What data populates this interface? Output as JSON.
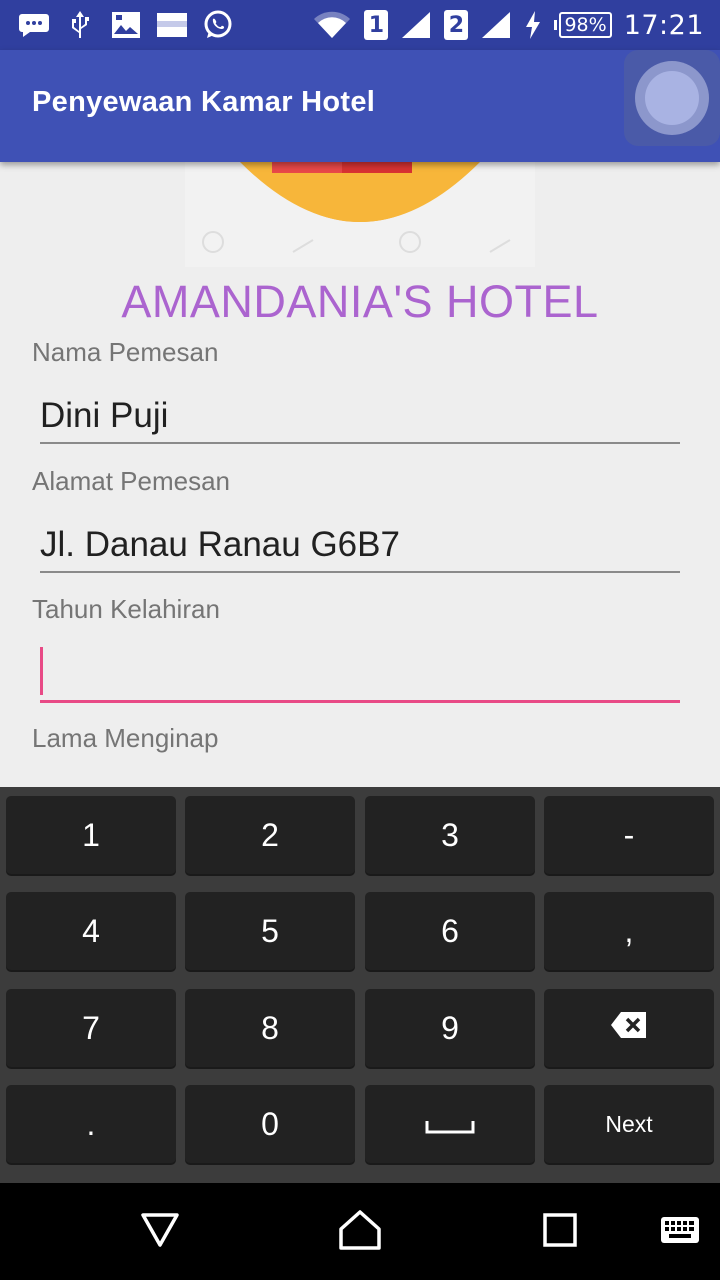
{
  "status_bar": {
    "time": "17:21",
    "battery": "98%",
    "sim1": "1",
    "sim2": "2",
    "icons": [
      "chat-icon",
      "usb-icon",
      "image-icon",
      "gallery-icon",
      "whatsapp-icon",
      "wifi-icon",
      "signal-icon",
      "charging-icon"
    ]
  },
  "toolbar": {
    "title": "Penyewaan Kamar Hotel"
  },
  "hotel_name": "AMANDANIA'S HOTEL",
  "form": {
    "nama_label": "Nama Pemesan",
    "nama_value": "Dini Puji",
    "alamat_label": "Alamat Pemesan",
    "alamat_value": "Jl. Danau Ranau G6B7",
    "tahun_label": "Tahun Kelahiran",
    "tahun_value": "",
    "lama_label": "Lama Menginap"
  },
  "keyboard": {
    "keys": [
      "1",
      "2",
      "3",
      "-",
      "4",
      "5",
      "6",
      ",",
      "7",
      "8",
      "9",
      "backspace",
      ".",
      "0",
      "space",
      "Next"
    ]
  },
  "colors": {
    "status_bar": "#303f9f",
    "toolbar": "#3f51b5",
    "accent": "#e84a86",
    "hotel_name": "#ab64cf"
  }
}
